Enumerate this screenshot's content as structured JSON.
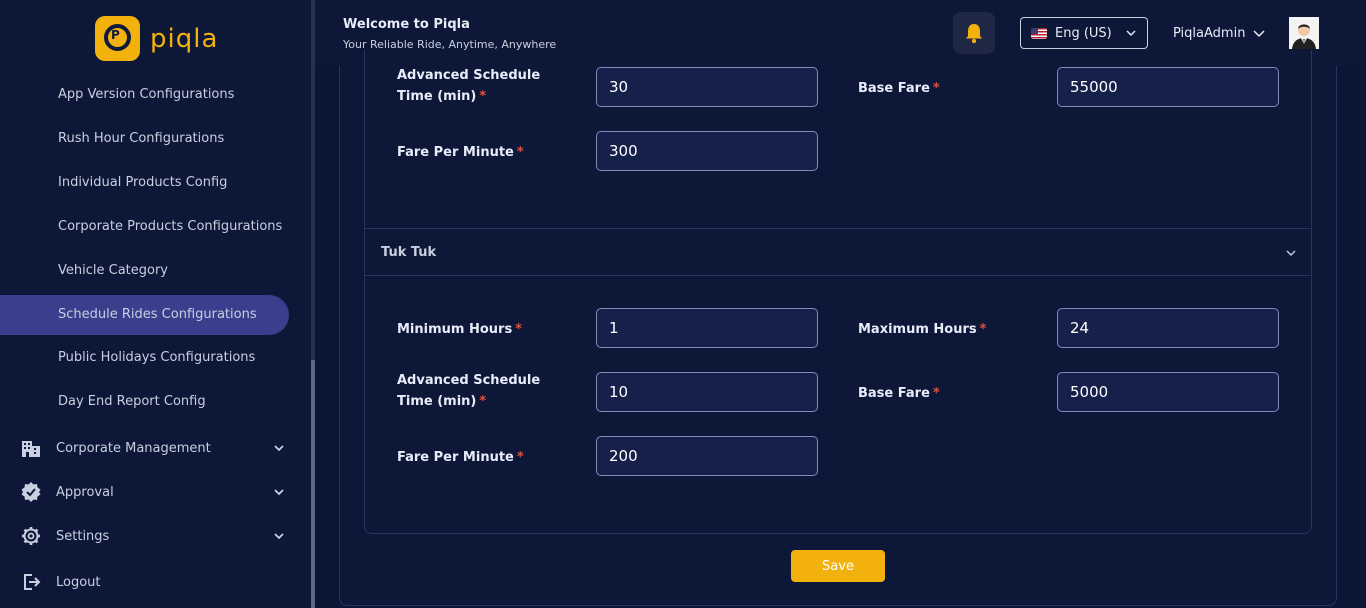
{
  "brand": {
    "logo_text": "piqla",
    "logo_badge": "P"
  },
  "sidebar": {
    "items": [
      {
        "label": "App Version Configurations"
      },
      {
        "label": "Rush Hour Configurations"
      },
      {
        "label": "Individual Products Config"
      },
      {
        "label": "Corporate Products Configurations"
      },
      {
        "label": "Vehicle Category"
      },
      {
        "label": "Schedule Rides Configurations",
        "active": true
      },
      {
        "label": "Public Holidays Configurations"
      },
      {
        "label": "Day End Report Config"
      }
    ],
    "groups": [
      {
        "label": "Corporate Management",
        "icon": "building-icon"
      },
      {
        "label": "Approval",
        "icon": "badge-check-icon"
      },
      {
        "label": "Settings",
        "icon": "gear-icon"
      }
    ],
    "logout": {
      "label": "Logout",
      "icon": "logout-icon"
    }
  },
  "header": {
    "welcome": "Welcome to Piqla",
    "tagline": "Your Reliable Ride, Anytime, Anywhere",
    "language": "Eng (US)",
    "user_name": "PiqlaAdmin"
  },
  "colors": {
    "accent": "#f2b10d",
    "active_nav": "#393f8c",
    "required": "#e2503f"
  },
  "form": {
    "top_section": {
      "advanced_schedule_label": "Advanced Schedule Time (min)",
      "advanced_schedule_value": "30",
      "base_fare_label": "Base Fare",
      "base_fare_value": "55000",
      "fare_per_minute_label": "Fare Per Minute",
      "fare_per_minute_value": "300"
    },
    "tuk_tuk": {
      "title": "Tuk Tuk",
      "minimum_hours_label": "Minimum Hours",
      "minimum_hours_value": "1",
      "maximum_hours_label": "Maximum Hours",
      "maximum_hours_value": "24",
      "advanced_schedule_label": "Advanced Schedule Time (min)",
      "advanced_schedule_value": "10",
      "base_fare_label": "Base Fare",
      "base_fare_value": "5000",
      "fare_per_minute_label": "Fare Per Minute",
      "fare_per_minute_value": "200"
    },
    "required_mark": "*",
    "save_label": "Save"
  }
}
